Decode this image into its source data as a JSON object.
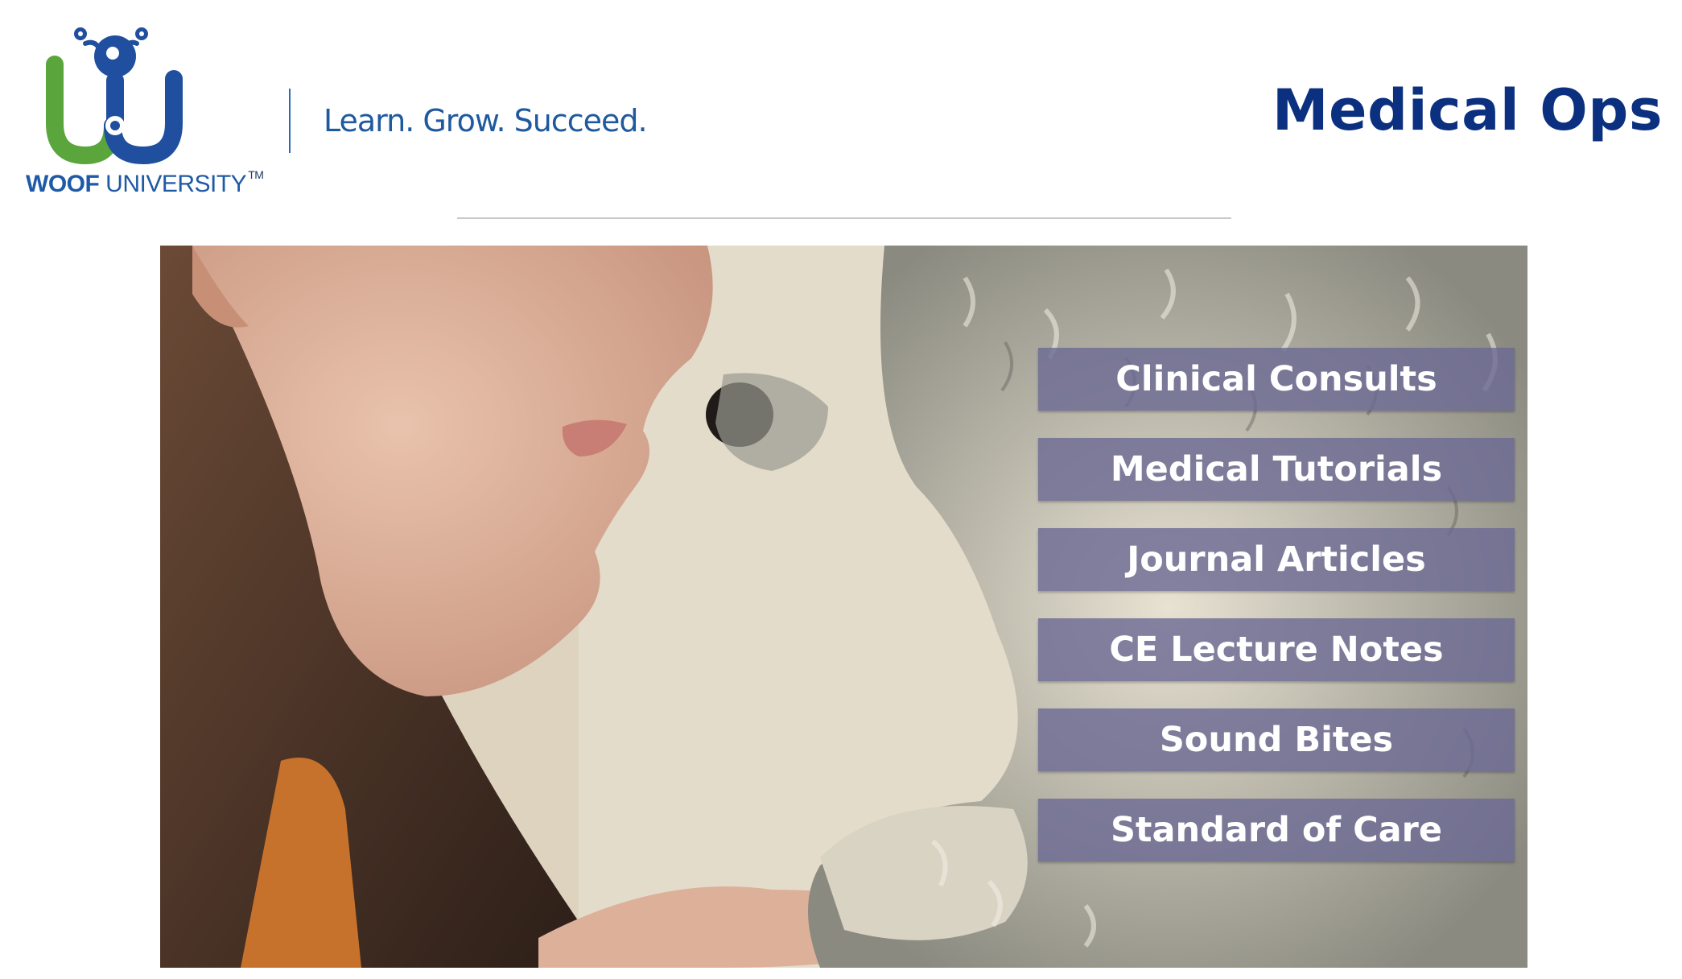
{
  "header": {
    "brand_bold": "WOOF",
    "brand_rest": " UNIVERSITY",
    "trademark": "TM",
    "tagline": "Learn. Grow. Succeed.",
    "title": "Medical Ops"
  },
  "menu": {
    "items": [
      {
        "label": "Clinical Consults"
      },
      {
        "label": "Medical Tutorials"
      },
      {
        "label": "Journal Articles"
      },
      {
        "label": "CE Lecture Notes"
      },
      {
        "label": "Sound Bites"
      },
      {
        "label": "Standard of Care"
      }
    ]
  },
  "colors": {
    "brand_blue": "#1f5aa6",
    "brand_green": "#5aa63c",
    "title_blue": "#0c3080",
    "button_fill": "#6c6994"
  },
  "icons": {
    "logo": "woof-university-logo-icon",
    "hero": "woman-and-dog-photo"
  }
}
